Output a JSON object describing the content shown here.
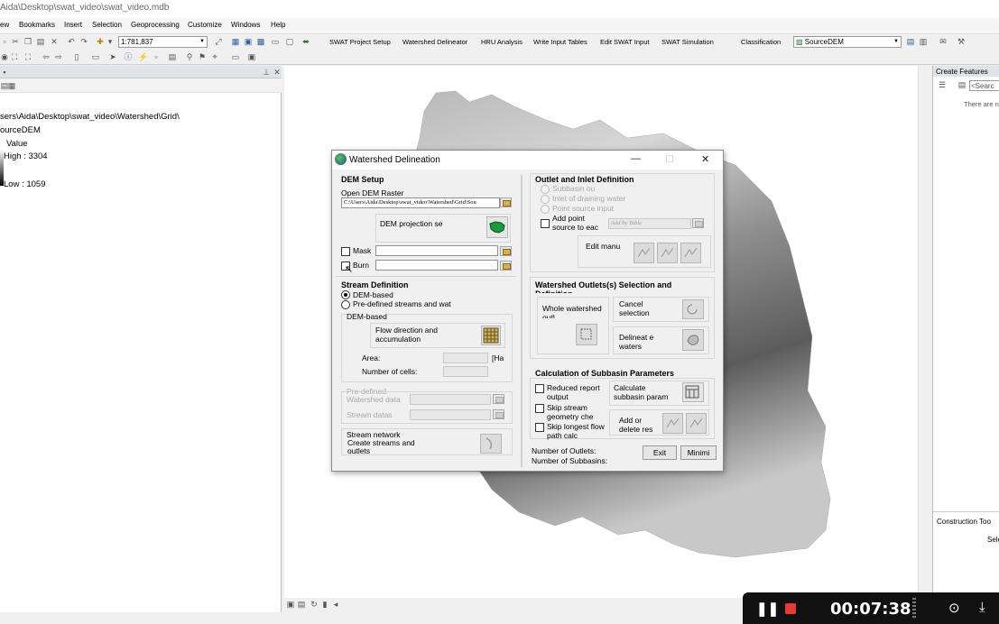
{
  "window_title": "Aida\\Desktop\\swat_video\\swat_video.mdb",
  "menu": [
    "ew",
    "Bookmarks",
    "Insert",
    "Selection",
    "Geoprocessing",
    "Customize",
    "Windows",
    "Help"
  ],
  "toolbar": {
    "scale": "1:781,837",
    "items": [
      "SWAT Project Setup",
      "Watershed Delineator",
      "HRU Analysis",
      "Write Input Tables",
      "Edit SWAT Input",
      "SWAT Simulation"
    ],
    "classification": "Classification",
    "layer": "SourceDEM"
  },
  "toc": {
    "path": "sers\\Aida\\Desktop\\swat_video\\Watershed\\Grid\\",
    "layer_name": "ourceDEM",
    "value_label": "Value",
    "high": "High : 3304",
    "low": "Low : 1059"
  },
  "right_panel": {
    "title": "Create Features",
    "search_placeholder": "<Searc",
    "empty_text": "There are n",
    "bottom_title": "Construction Too",
    "bottom_text": "Sele"
  },
  "dialog": {
    "title": "Watershed Delineation",
    "dem_setup": {
      "header": "DEM Setup",
      "open_label": "Open DEM Raster",
      "path": "C:\\Users\\Aida\\Desktop\\swat_video\\Watershed\\Grid\\Sou",
      "projection_label": "DEM projection se",
      "mask_label": "Mask",
      "burn_label": "Burn"
    },
    "stream_def": {
      "header": "Stream Definition",
      "opt_dem": "DEM-based",
      "opt_predef": "Pre-defined streams and wat",
      "dem_group": "DEM-based",
      "flow_label": "Flow direction and accumulation",
      "area_label": "Area:",
      "area_unit": "[Ha",
      "cells_label": "Number of cells:",
      "predef_group": "Pre-defined",
      "watershed_data": "Watershed data",
      "stream_data": "Stream datas",
      "network_group": "Stream network",
      "network_label": "Create streams and outlets"
    },
    "outlet_def": {
      "header": "Outlet and Inlet Definition",
      "opt_subbasin": "Subbasin ou",
      "opt_inlet": "Inlet of draining water",
      "opt_point": "Point source input",
      "add_point": "Add point source to eac",
      "add_by_table": "Add by Table",
      "edit_manual": "Edit manu"
    },
    "ws_outlets": {
      "header": "Watershed Outlets(s) Selection and Definition",
      "whole": "Whole watershed outl",
      "cancel": "Cancel selection",
      "delineate": "Delineat e waters"
    },
    "subbasin": {
      "header": "Calculation of Subbasin Parameters",
      "reduced": "Reduced report output",
      "skip_stream": "Skip stream geometry che",
      "skip_longest": "Skip longest flow path calc",
      "calculate": "Calculate subbasin param",
      "add_delete": "Add or delete res"
    },
    "footer": {
      "outlets": "Number of Outlets:",
      "subbasins": "Number of Subbasins:",
      "exit": "Exit",
      "minimize": "Minimi"
    }
  },
  "recorder": {
    "time": "00:07:38"
  }
}
